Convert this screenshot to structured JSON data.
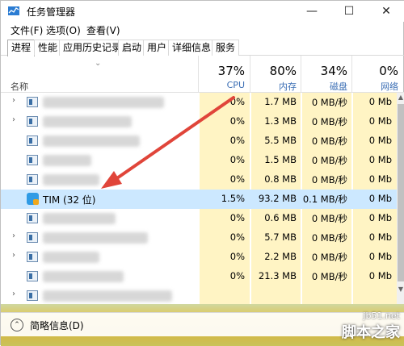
{
  "window": {
    "title": "任务管理器",
    "minimize_glyph": "—",
    "maximize_glyph": "☐",
    "close_glyph": "✕"
  },
  "menu": [
    "文件(F)",
    "选项(O)",
    "查看(V)"
  ],
  "tabs": [
    "进程",
    "性能",
    "应用历史记录",
    "启动",
    "用户",
    "详细信息",
    "服务"
  ],
  "active_tab": "进程",
  "header": {
    "sort_glyph": "⌄",
    "name_label": "名称",
    "columns": [
      {
        "pct": "37%",
        "label": "CPU"
      },
      {
        "pct": "80%",
        "label": "内存"
      },
      {
        "pct": "34%",
        "label": "磁盘"
      },
      {
        "pct": "0%",
        "label": "网络"
      }
    ]
  },
  "rows": [
    {
      "name": "",
      "expandable": true,
      "cpu": "0%",
      "mem": "1.7 MB",
      "disk": "0 MB/秒",
      "net": "0 Mb"
    },
    {
      "name": "",
      "expandable": true,
      "cpu": "0%",
      "mem": "1.3 MB",
      "disk": "0 MB/秒",
      "net": "0 Mb"
    },
    {
      "name": "",
      "expandable": false,
      "cpu": "0%",
      "mem": "5.5 MB",
      "disk": "0 MB/秒",
      "net": "0 Mb"
    },
    {
      "name": "",
      "expandable": false,
      "cpu": "0%",
      "mem": "1.5 MB",
      "disk": "0 MB/秒",
      "net": "0 Mb"
    },
    {
      "name": "",
      "expandable": false,
      "cpu": "0%",
      "mem": "0.8 MB",
      "disk": "0 MB/秒",
      "net": "0 Mb"
    },
    {
      "name": "TIM (32 位)",
      "expandable": false,
      "cpu": "1.5%",
      "mem": "93.2 MB",
      "disk": "0.1 MB/秒",
      "net": "0 Mb",
      "selected": true
    },
    {
      "name": "",
      "expandable": false,
      "cpu": "0%",
      "mem": "0.6 MB",
      "disk": "0 MB/秒",
      "net": "0 Mb"
    },
    {
      "name": "",
      "expandable": true,
      "cpu": "0%",
      "mem": "5.7 MB",
      "disk": "0 MB/秒",
      "net": "0 Mb"
    },
    {
      "name": "",
      "expandable": true,
      "cpu": "0%",
      "mem": "2.2 MB",
      "disk": "0 MB/秒",
      "net": "0 Mb"
    },
    {
      "name": "",
      "expandable": false,
      "cpu": "0%",
      "mem": "21.3 MB",
      "disk": "0 MB/秒",
      "net": "0 Mb"
    },
    {
      "name": "",
      "expandable": true,
      "cpu": "",
      "mem": "",
      "disk": "",
      "net": ""
    }
  ],
  "expand_glyph": "›",
  "scroll": {
    "up_glyph": "▲",
    "down_glyph": "▼"
  },
  "footer": {
    "fewer_glyph": "⌃",
    "fewer_details": "简略信息(D)"
  },
  "watermark": {
    "url": "jb51.net",
    "name": "脚本之家"
  },
  "colors": {
    "highlight": "#fff4c4",
    "selected": "#cce8ff",
    "header_label": "#3c6fb5",
    "arrow": "#e0453a"
  }
}
